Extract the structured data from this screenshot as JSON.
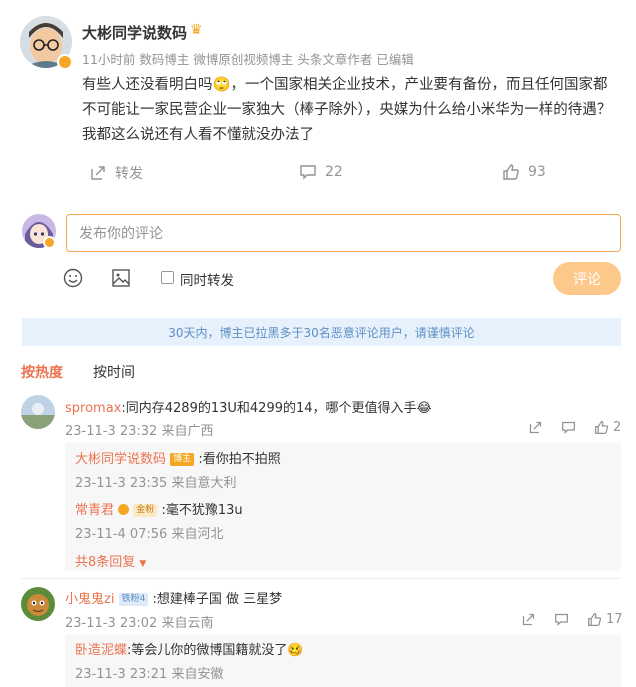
{
  "post": {
    "author": "大彬同学说数码",
    "meta": "11小时前  数码博主 微博原创视频博主 头条文章作者 已编辑",
    "text": "有些人还没看明白吗🙄，一个国家相关企业技术，产业要有备份，而且任何国家都不可能让一家民营企业一家独大（棒子除外），央媒为什么给小米华为一样的待遇？我都这么说还有人看不懂就没办法了",
    "repost_label": "转发",
    "comment_count": "22",
    "like_count": "93"
  },
  "composer": {
    "placeholder": "发布你的评论",
    "also_repost_label": "同时转发",
    "submit_label": "评论"
  },
  "notice": "30天内，博主已拉黑多于30名恶意评论用户，请谨慎评论",
  "tabs": {
    "hot": "按热度",
    "time": "按时间"
  },
  "comments": [
    {
      "user": "spromax",
      "text": ":同内存4289的13U和4299的14，哪个更值得入手😂",
      "time": "23-11-3 23:32 来自广西",
      "likes": "2",
      "replies": [
        {
          "user": "大彬同学说数码",
          "badge": "博主",
          "text": ":看你拍不拍照",
          "time": "23-11-3 23:35 来自意大利"
        },
        {
          "user": "常青君",
          "badge": "金粉",
          "text": ":毫不犹豫13u",
          "time": "23-11-4 07:56 来自河北"
        }
      ],
      "more": "共8条回复"
    },
    {
      "user": "小鬼鬼zi",
      "badge": "铁粉4",
      "text": ":想建棒子国 做 三星梦",
      "time": "23-11-3 23:02 来自云南",
      "likes": "17",
      "replies": [
        {
          "user": "卧造泥蝶",
          "text": ":等会儿你的微博国籍就没了🥴",
          "time": "23-11-3 23:21 来自安徽"
        }
      ]
    }
  ],
  "colors": {
    "accent": "#eb7350",
    "orange_border": "#f4a650",
    "notice_bg": "#e7f1fb"
  }
}
